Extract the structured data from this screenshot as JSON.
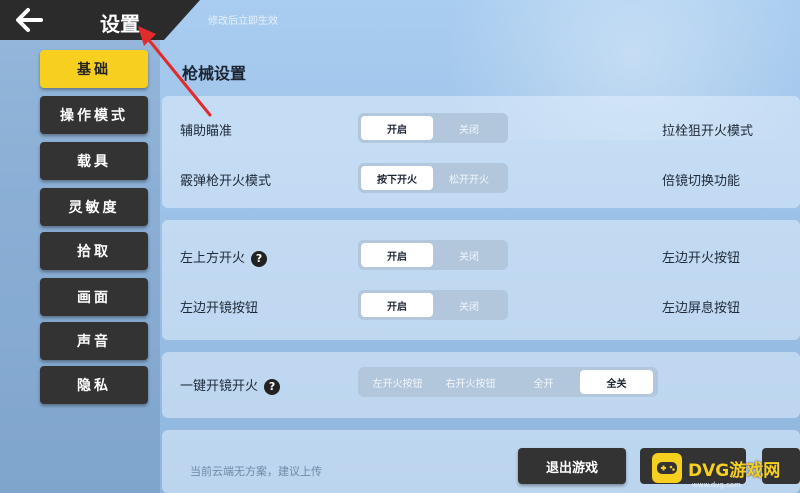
{
  "header": {
    "title": "设置",
    "subtitle": "修改后立即生效"
  },
  "sidebar": {
    "items": [
      {
        "label": "基础",
        "active": true
      },
      {
        "label": "操作模式",
        "active": false
      },
      {
        "label": "载具",
        "active": false
      },
      {
        "label": "灵敏度",
        "active": false
      },
      {
        "label": "拾取",
        "active": false
      },
      {
        "label": "画面",
        "active": false
      },
      {
        "label": "声音",
        "active": false
      },
      {
        "label": "隐私",
        "active": false
      }
    ]
  },
  "main": {
    "section_title": "枪械设置",
    "rows": [
      {
        "label": "辅助瞄准",
        "options": [
          "开启",
          "关闭"
        ],
        "selected": 0,
        "right_label": "拉栓狙开火模式"
      },
      {
        "label": "霰弹枪开火模式",
        "options": [
          "按下开火",
          "松开开火"
        ],
        "selected": 0,
        "right_label": "倍镜切换功能"
      },
      {
        "label": "左上方开火",
        "options": [
          "开启",
          "关闭"
        ],
        "selected": 0,
        "right_label": "左边开火按钮",
        "help": "?"
      },
      {
        "label": "左边开镜按钮",
        "options": [
          "开启",
          "关闭"
        ],
        "selected": 0,
        "right_label": "左边屏息按钮"
      },
      {
        "label": "一键开镜开火",
        "options": [
          "左开火按钮",
          "右开火按钮",
          "全开",
          "全关"
        ],
        "selected": 3,
        "help": "?"
      }
    ]
  },
  "footer": {
    "hint": "当前云端无方案，建议上传",
    "exit_label": "退出游戏"
  },
  "watermark": {
    "text": "DVG游戏网",
    "url": "www.dvg.com"
  },
  "colors": {
    "accent": "#f6cf1f",
    "button_dark": "#333333",
    "toggle_bg": "#b2c7dc"
  }
}
